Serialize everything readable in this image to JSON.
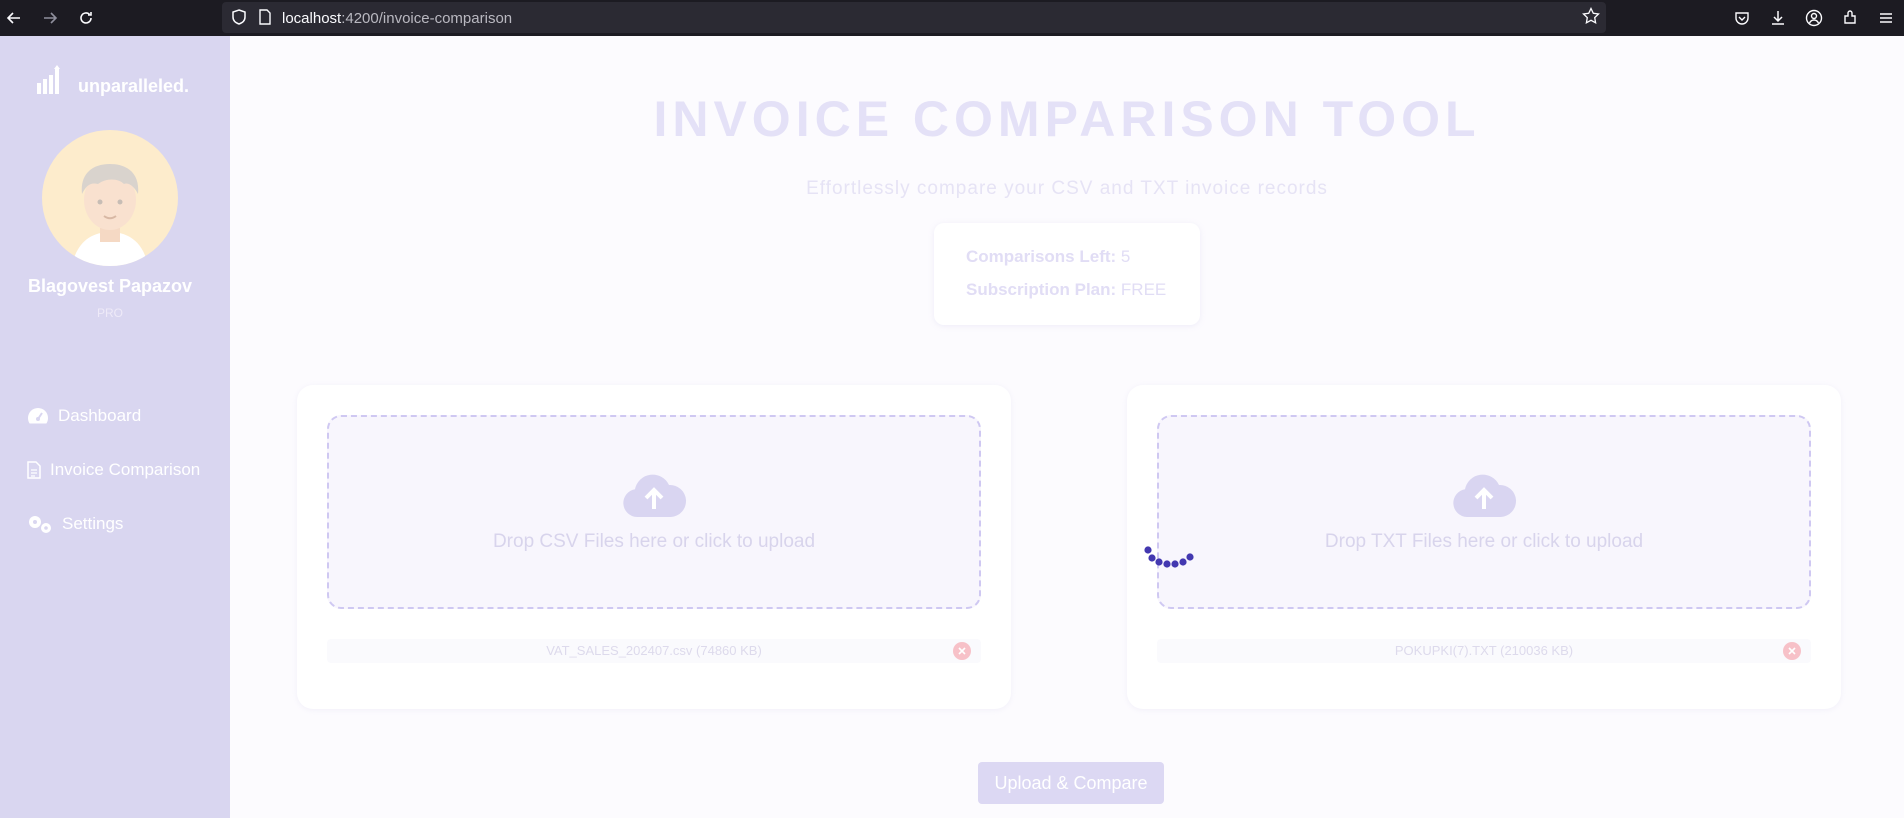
{
  "browser": {
    "url_host": "localhost",
    "url_path": ":4200/invoice-comparison"
  },
  "sidebar": {
    "brand": "unparalleled.",
    "user_name": "Blagovest Papazov",
    "user_plan": "PRO",
    "items": [
      {
        "label": "Dashboard",
        "icon": "gauge-icon"
      },
      {
        "label": "Invoice Comparison",
        "icon": "document-icon"
      },
      {
        "label": "Settings",
        "icon": "gears-icon"
      }
    ]
  },
  "main": {
    "title": "INVOICE COMPARISON TOOL",
    "subtitle": "Effortlessly compare your CSV and TXT invoice records",
    "info": {
      "comparisons_label": "Comparisons Left:",
      "comparisons_value": "5",
      "plan_label": "Subscription Plan:",
      "plan_value": "FREE"
    },
    "csv_panel": {
      "dropzone_text": "Drop CSV Files here or click to upload",
      "file": "VAT_SALES_202407.csv (74860 KB)"
    },
    "txt_panel": {
      "dropzone_text": "Drop TXT Files here or click to upload",
      "file": "POKUPKI(7).TXT (210036 KB)"
    },
    "submit_label": "Upload & Compare"
  },
  "colors": {
    "sidebar_bg": "#d9d6f0",
    "accent": "#4338b0",
    "danger": "#f7c1c8"
  }
}
